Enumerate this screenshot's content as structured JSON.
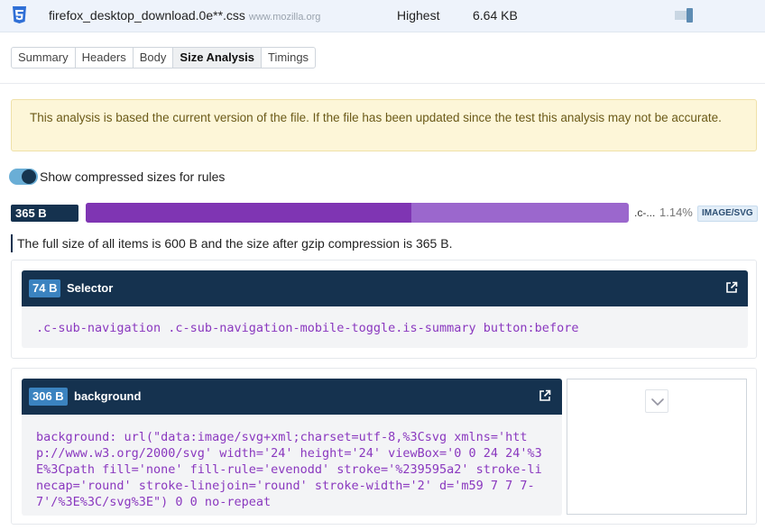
{
  "request": {
    "filename": "firefox_desktop_download.0e**.css",
    "domain": "www.mozilla.org",
    "priority": "Highest",
    "size": "6.64 KB",
    "file_icon": "css3-icon"
  },
  "tabs": [
    {
      "label": "Summary",
      "active": false
    },
    {
      "label": "Headers",
      "active": false
    },
    {
      "label": "Body",
      "active": false
    },
    {
      "label": "Size Analysis",
      "active": true
    },
    {
      "label": "Timings",
      "active": false
    }
  ],
  "notice": {
    "text": "This analysis is based the current version of the file. If the file has been updated since the test this analysis may not be accurate."
  },
  "toggle": {
    "label": "Show compressed sizes for rules",
    "on": true
  },
  "size_bar": {
    "total_badge": "365 B",
    "label": ".c-...",
    "percent": "1.14%",
    "type_badge": "IMAGE/SVG",
    "primary_fraction": 0.6
  },
  "summary": {
    "text": "The full size of all items is 600 B and the size after gzip compression is 365 B."
  },
  "selector_card": {
    "badge": "74 B",
    "title": "Selector",
    "code": ".c-sub-navigation .c-sub-navigation-mobile-toggle.is-summary button:before",
    "open_icon": "external-link-icon"
  },
  "background_card": {
    "badge": "306 B",
    "title": "background",
    "code": "background: url(\"data:image/svg+xml;charset=utf-8,%3Csvg xmlns='http://www.w3.org/2000/svg' width='24' height='24' viewBox='0 0 24 24'%3E%3Cpath fill='none' fill-rule='evenodd' stroke='%239595a2' stroke-linecap='round' stroke-linejoin='round' stroke-width='2' d='m59 7 7 7-7'/%3E%3C/svg%3E\") 0 0 no-repeat",
    "open_icon": "external-link-icon",
    "preview_icon": "chevron-down-icon"
  },
  "colors": {
    "navy": "#15324f",
    "accent_blue": "#3b83c0",
    "bar_dark": "#7f35b3",
    "bar_light": "#9b67cd",
    "code_purple": "#8a38bf",
    "notice_bg": "#fdf6d8"
  }
}
